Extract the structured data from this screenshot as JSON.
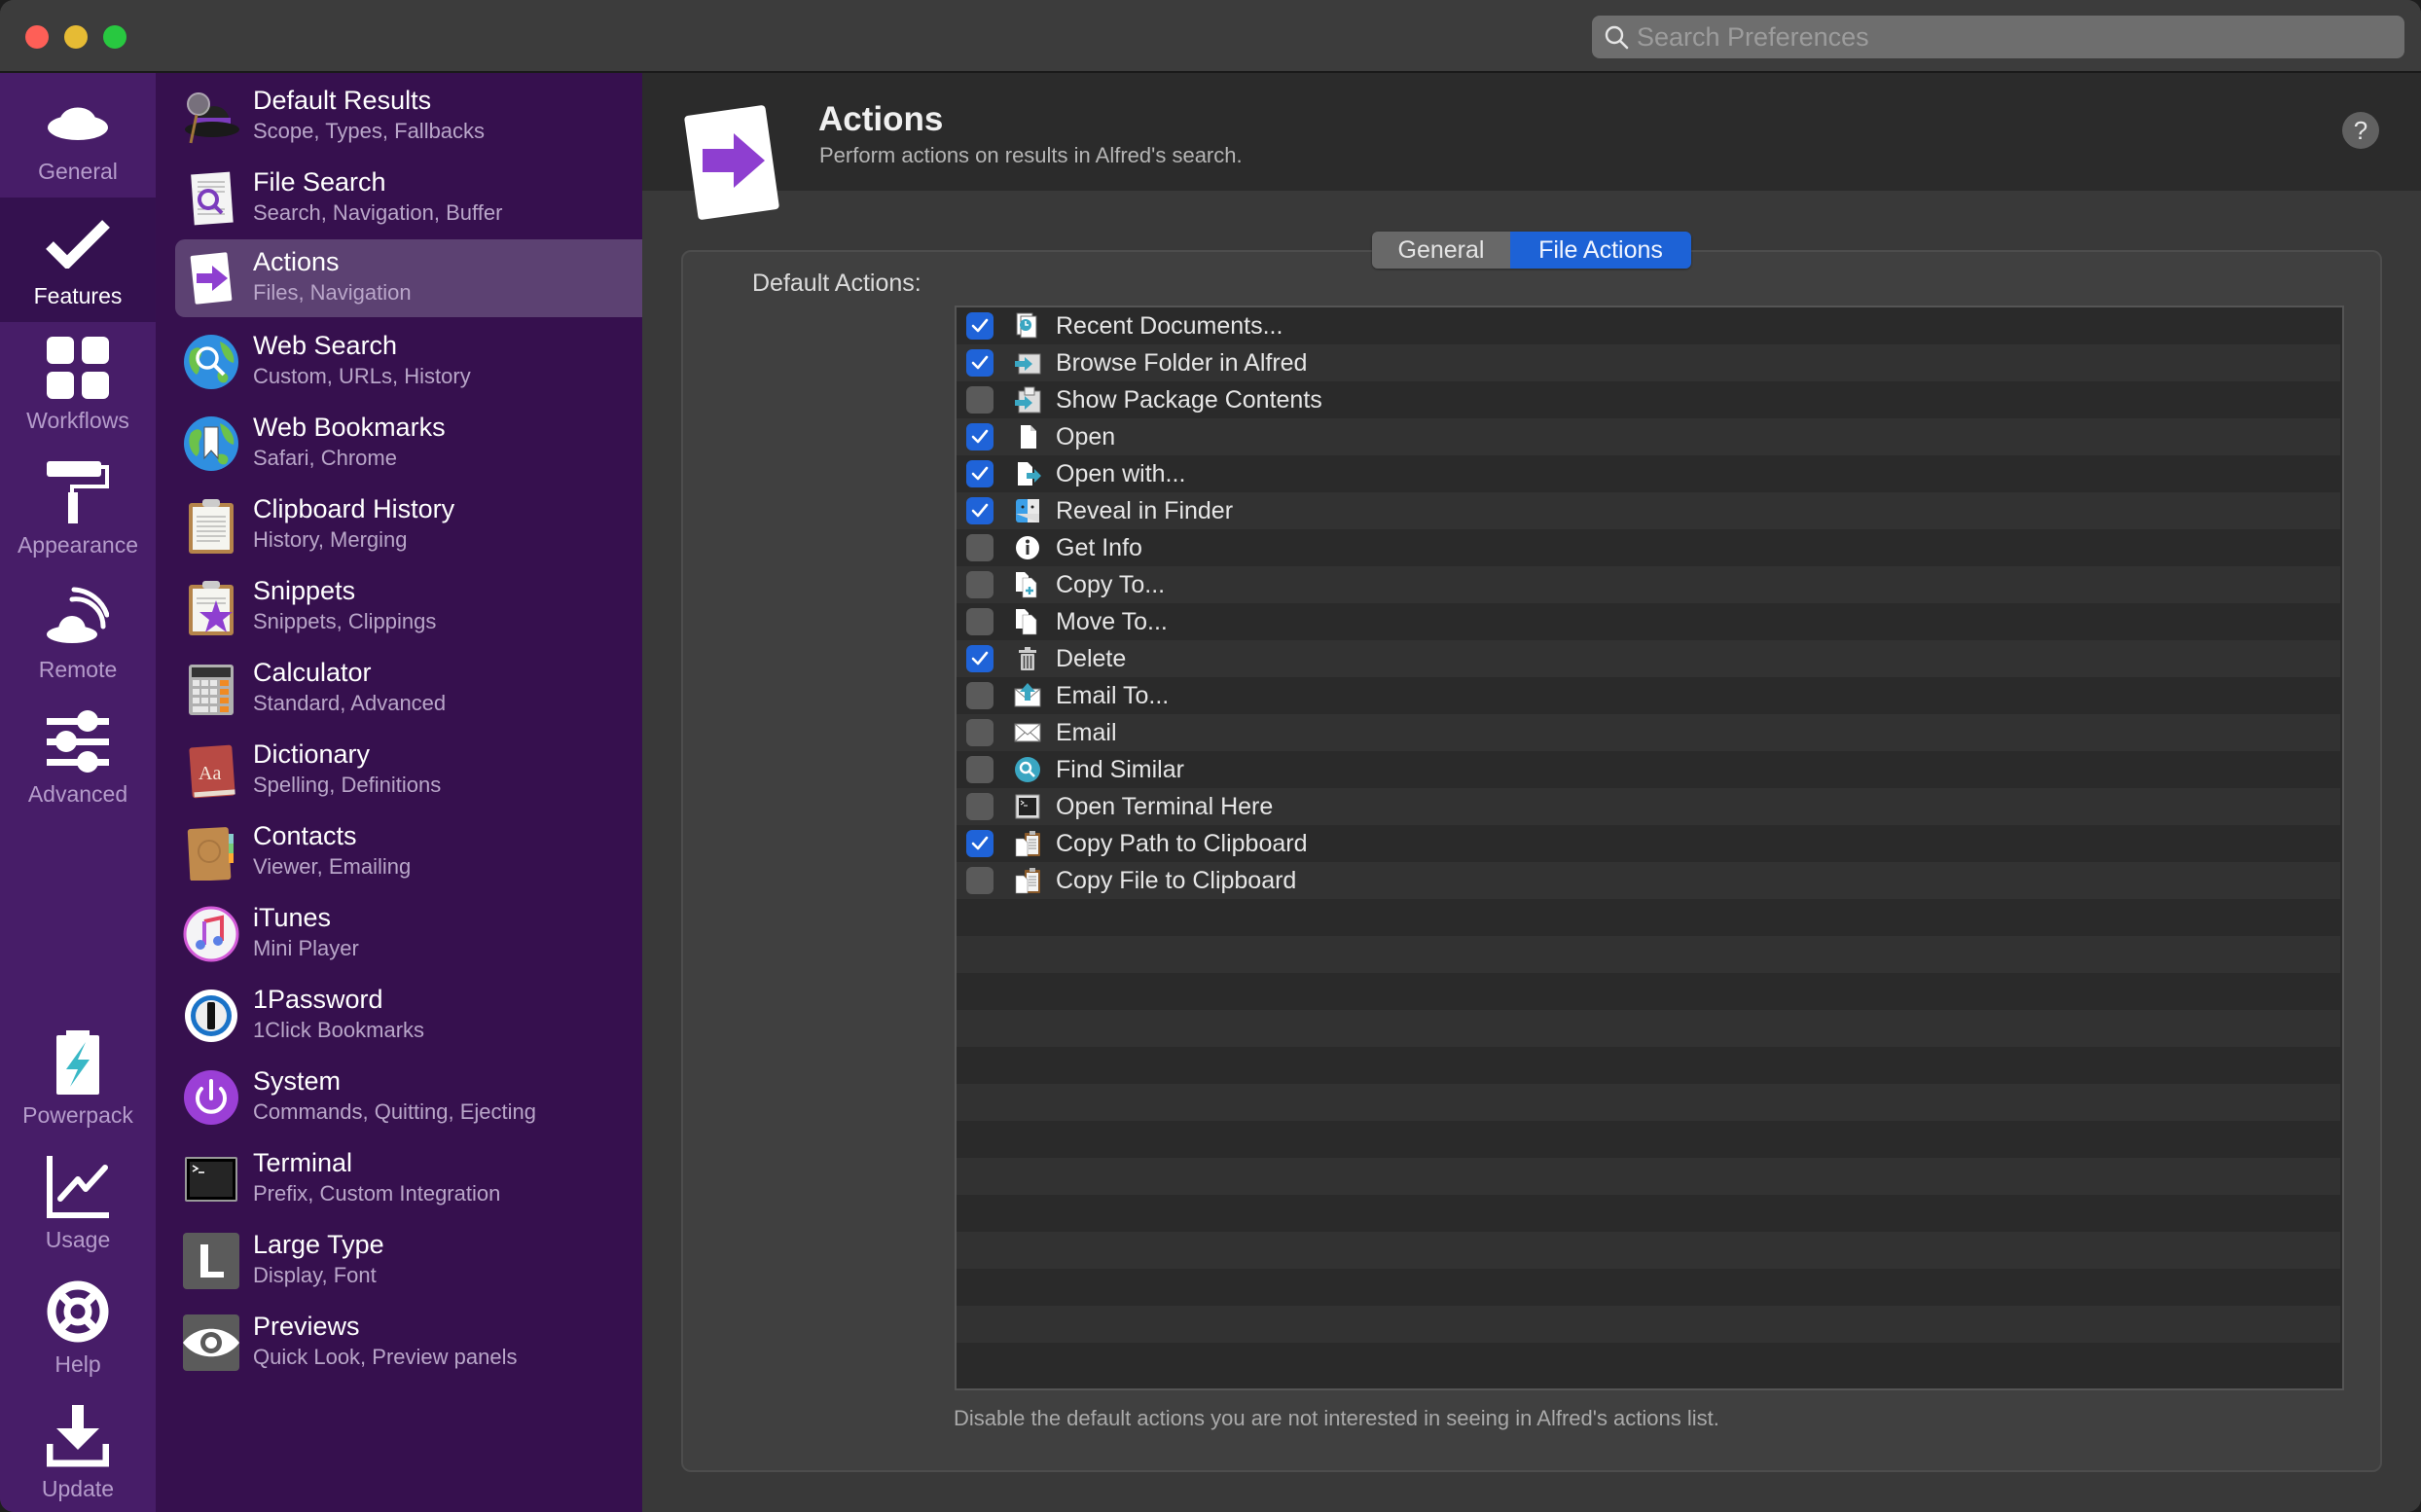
{
  "window": {
    "search_placeholder": "Search Preferences",
    "search_value": ""
  },
  "rail": {
    "top_items": [
      {
        "label": "General",
        "icon": "hat-icon",
        "selected": false
      },
      {
        "label": "Features",
        "icon": "checkmark-icon",
        "selected": true
      },
      {
        "label": "Workflows",
        "icon": "grid-icon",
        "selected": false
      },
      {
        "label": "Appearance",
        "icon": "paint-roller-icon",
        "selected": false
      },
      {
        "label": "Remote",
        "icon": "remote-hat-icon",
        "selected": false
      },
      {
        "label": "Advanced",
        "icon": "sliders-icon",
        "selected": false
      }
    ],
    "bottom_items": [
      {
        "label": "Powerpack",
        "icon": "battery-bolt-icon"
      },
      {
        "label": "Usage",
        "icon": "line-chart-icon"
      },
      {
        "label": "Help",
        "icon": "lifebuoy-icon"
      },
      {
        "label": "Update",
        "icon": "download-icon"
      }
    ]
  },
  "sidebar": {
    "selected_index": 2,
    "items": [
      {
        "title": "Default Results",
        "subtitle": "Scope, Types, Fallbacks",
        "icon": "alfred-hat-icon"
      },
      {
        "title": "File Search",
        "subtitle": "Search, Navigation, Buffer",
        "icon": "file-search-icon"
      },
      {
        "title": "Actions",
        "subtitle": "Files, Navigation",
        "icon": "actions-arrow-icon"
      },
      {
        "title": "Web Search",
        "subtitle": "Custom, URLs, History",
        "icon": "globe-search-icon"
      },
      {
        "title": "Web Bookmarks",
        "subtitle": "Safari, Chrome",
        "icon": "globe-bookmark-icon"
      },
      {
        "title": "Clipboard History",
        "subtitle": "History, Merging",
        "icon": "clipboard-icon"
      },
      {
        "title": "Snippets",
        "subtitle": "Snippets, Clippings",
        "icon": "clipboard-star-icon"
      },
      {
        "title": "Calculator",
        "subtitle": "Standard, Advanced",
        "icon": "calculator-icon"
      },
      {
        "title": "Dictionary",
        "subtitle": "Spelling, Definitions",
        "icon": "dictionary-icon"
      },
      {
        "title": "Contacts",
        "subtitle": "Viewer, Emailing",
        "icon": "contacts-icon"
      },
      {
        "title": "iTunes",
        "subtitle": "Mini Player",
        "icon": "itunes-icon"
      },
      {
        "title": "1Password",
        "subtitle": "1Click Bookmarks",
        "icon": "1password-icon"
      },
      {
        "title": "System",
        "subtitle": "Commands, Quitting, Ejecting",
        "icon": "power-icon"
      },
      {
        "title": "Terminal",
        "subtitle": "Prefix, Custom Integration",
        "icon": "terminal-icon"
      },
      {
        "title": "Large Type",
        "subtitle": "Display, Font",
        "icon": "large-type-icon"
      },
      {
        "title": "Previews",
        "subtitle": "Quick Look, Preview panels",
        "icon": "eye-icon"
      }
    ]
  },
  "main": {
    "title": "Actions",
    "subtitle": "Perform actions on results in Alfred's search.",
    "help_label": "?",
    "tabs": [
      {
        "label": "General",
        "active": false
      },
      {
        "label": "File Actions",
        "active": true
      }
    ],
    "default_actions_label": "Default Actions:",
    "actions": [
      {
        "label": "Recent Documents...",
        "checked": true,
        "icon": "recent-documents-icon"
      },
      {
        "label": "Browse Folder in Alfred",
        "checked": true,
        "icon": "browse-folder-icon"
      },
      {
        "label": "Show Package Contents",
        "checked": false,
        "icon": "package-contents-icon"
      },
      {
        "label": "Open",
        "checked": true,
        "icon": "document-icon"
      },
      {
        "label": "Open with...",
        "checked": true,
        "icon": "open-with-icon"
      },
      {
        "label": "Reveal in Finder",
        "checked": true,
        "icon": "finder-icon"
      },
      {
        "label": "Get Info",
        "checked": false,
        "icon": "info-icon"
      },
      {
        "label": "Copy To...",
        "checked": false,
        "icon": "copy-to-icon"
      },
      {
        "label": "Move To...",
        "checked": false,
        "icon": "move-to-icon"
      },
      {
        "label": "Delete",
        "checked": true,
        "icon": "trash-icon"
      },
      {
        "label": "Email To...",
        "checked": false,
        "icon": "email-to-icon"
      },
      {
        "label": "Email",
        "checked": false,
        "icon": "envelope-icon"
      },
      {
        "label": "Find Similar",
        "checked": false,
        "icon": "find-similar-icon"
      },
      {
        "label": "Open Terminal Here",
        "checked": false,
        "icon": "terminal-small-icon"
      },
      {
        "label": "Copy Path to Clipboard",
        "checked": true,
        "icon": "clipboard-copy-icon"
      },
      {
        "label": "Copy File to Clipboard",
        "checked": false,
        "icon": "clipboard-copy-icon"
      }
    ],
    "footnote": "Disable the default actions you are not interested in seeing in Alfred's actions list."
  },
  "colors": {
    "rail_bg": "#471d68",
    "sidebar_bg": "#36104e",
    "sidebar_selected": "#5c4172",
    "accent_blue": "#1f63d8",
    "actions_purple": "#8e3fd0"
  }
}
